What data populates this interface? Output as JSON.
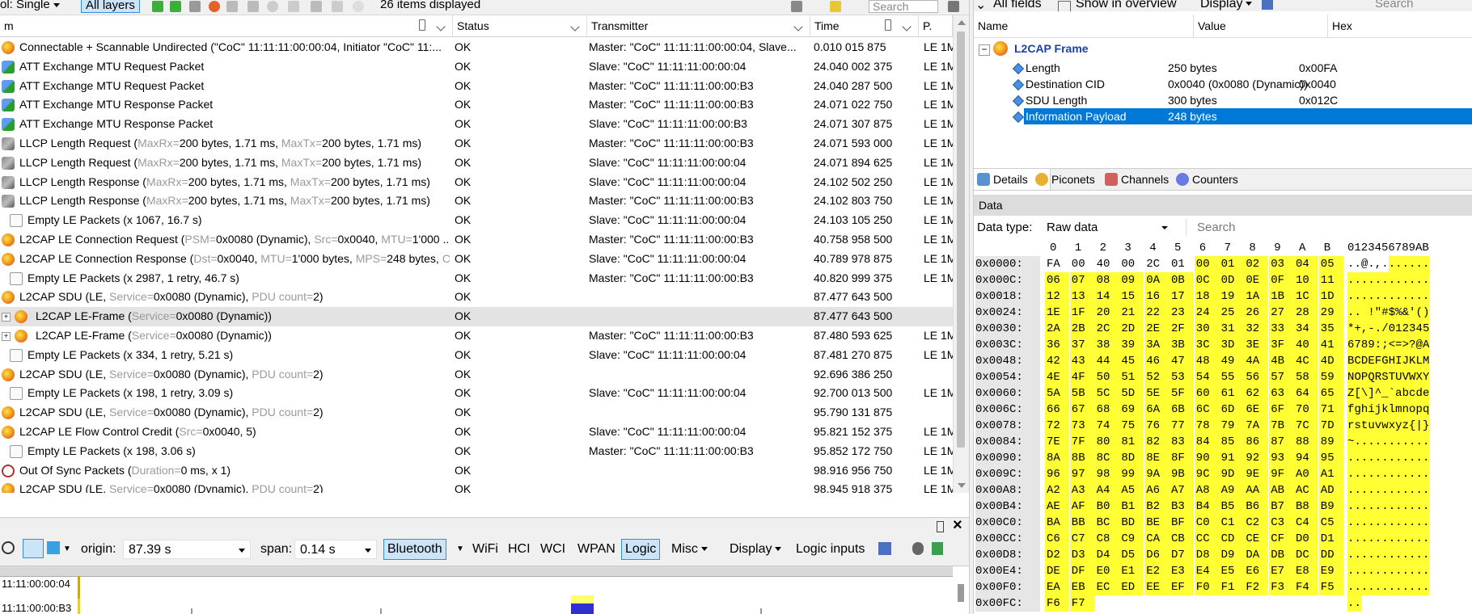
{
  "left_toolbar": {
    "pol_label": "ol: Single",
    "layers_label": "All layers",
    "items_displayed": "26 items displayed",
    "search_placeholder": "Search"
  },
  "packet_table": {
    "headers": {
      "name": "m",
      "status": "Status",
      "transmitter": "Transmitter",
      "time": "Time",
      "p": "P."
    },
    "rows": [
      {
        "icon": "exclamation-icon",
        "name": "Connectable + Scannable Undirected (\"CoC\" 11:11:11:00:00:04, Initiator \"CoC\" 11:...",
        "status": "OK",
        "transmitter": "Master: \"CoC\" 11:11:11:00:00:04, Slave...",
        "time": "0.010 015 875",
        "p": "LE 1M"
      },
      {
        "icon": "arrow-icon",
        "name": "ATT Exchange MTU Request Packet",
        "status": "OK",
        "transmitter": "Slave: \"CoC\" 11:11:11:00:00:04",
        "time": "24.040 002 375",
        "p": "LE 1M"
      },
      {
        "icon": "arrow-icon",
        "name": "ATT Exchange MTU Request Packet",
        "status": "OK",
        "transmitter": "Master: \"CoC\" 11:11:11:00:00:B3",
        "time": "24.040 287 500",
        "p": "LE 1M"
      },
      {
        "icon": "arrow-icon",
        "name": "ATT Exchange MTU Response Packet",
        "status": "OK",
        "transmitter": "Master: \"CoC\" 11:11:11:00:00:B3",
        "time": "24.071 022 750",
        "p": "LE 1M"
      },
      {
        "icon": "arrow-icon",
        "name": "ATT Exchange MTU Response Packet",
        "status": "OK",
        "transmitter": "Slave: \"CoC\" 11:11:11:00:00:B3",
        "time": "24.071 307 875",
        "p": "LE 1M"
      },
      {
        "icon": "llcp-icon",
        "name": "LLCP Length Request (",
        "g1": "MaxRx=",
        "v1": "200 bytes, 1.71 ms, ",
        "g2": "MaxTx=",
        "v2": "200 bytes, 1.71 ms)",
        "status": "OK",
        "transmitter": "Master: \"CoC\" 11:11:11:00:00:B3",
        "time": "24.071 593 000",
        "p": "LE 1M"
      },
      {
        "icon": "llcp-icon",
        "name": "LLCP Length Request (",
        "g1": "MaxRx=",
        "v1": "200 bytes, 1.71 ms, ",
        "g2": "MaxTx=",
        "v2": "200 bytes, 1.71 ms)",
        "status": "OK",
        "transmitter": "Slave: \"CoC\" 11:11:11:00:00:04",
        "time": "24.071 894 625",
        "p": "LE 1M"
      },
      {
        "icon": "llcp-icon",
        "name": "LLCP Length Response (",
        "g1": "MaxRx=",
        "v1": "200 bytes, 1.71 ms, ",
        "g2": "MaxTx=",
        "v2": "200 bytes, 1.71 ms)",
        "status": "OK",
        "transmitter": "Slave: \"CoC\" 11:11:11:00:00:04",
        "time": "24.102 502 250",
        "p": "LE 1M"
      },
      {
        "icon": "llcp-icon",
        "name": "LLCP Length Response (",
        "g1": "MaxRx=",
        "v1": "200 bytes, 1.71 ms, ",
        "g2": "MaxTx=",
        "v2": "200 bytes, 1.71 ms)",
        "status": "OK",
        "transmitter": "Master: \"CoC\" 11:11:11:00:00:B3",
        "time": "24.102 803 750",
        "p": "LE 1M"
      },
      {
        "icon": "empty-icon",
        "name": "Empty LE Packets (x 1067, 16.7 s)",
        "status": "OK",
        "transmitter": "Slave: \"CoC\" 11:11:11:00:00:04",
        "time": "24.103 105 250",
        "p": "LE 1M"
      },
      {
        "icon": "l2cap-icon",
        "name": "L2CAP LE Connection Request (",
        "g1": "PSM=",
        "v1": "0x0080 (Dynamic), ",
        "g2": "Src=",
        "v2": "0x0040, ",
        "g3": "MTU=",
        "v3": "1'000 ...",
        "status": "OK",
        "transmitter": "Master: \"CoC\" 11:11:11:00:00:B3",
        "time": "40.758 958 500",
        "p": "LE 1M"
      },
      {
        "icon": "l2cap-icon",
        "name": "L2CAP LE Connection Response (",
        "g1": "Dst=",
        "v1": "0x0040, ",
        "g2": "MTU=",
        "v2": "1'000 bytes, ",
        "g3": "MPS=",
        "v3": "248 bytes, ",
        "g4": "C...",
        "status": "OK",
        "transmitter": "Slave: \"CoC\" 11:11:11:00:00:04",
        "time": "40.789 978 875",
        "p": "LE 1M"
      },
      {
        "icon": "empty-icon",
        "name": "Empty LE Packets (x 2987, 1 retry, 46.7 s)",
        "status": "OK",
        "transmitter": "Master: \"CoC\" 11:11:11:00:00:B3",
        "time": "40.820 999 375",
        "p": "LE 1M"
      },
      {
        "icon": "l2cap-icon",
        "name": "L2CAP SDU (LE, ",
        "g1": "Service=",
        "v1": "0x0080 (Dynamic), ",
        "g2": "PDU count=",
        "v2": "2)",
        "status": "OK",
        "transmitter": "",
        "time": "87.477 643 500",
        "p": ""
      },
      {
        "icon": "l2cap-icon",
        "expand": true,
        "selected": true,
        "name": "L2CAP LE-Frame (",
        "g1": "Service=",
        "v1": "0x0080 (Dynamic))",
        "status": "OK",
        "transmitter": "",
        "time": "87.477 643 500",
        "p": ""
      },
      {
        "icon": "l2cap-icon",
        "expand": true,
        "name": "L2CAP LE-Frame (",
        "g1": "Service=",
        "v1": "0x0080 (Dynamic))",
        "status": "OK",
        "transmitter": "Master: \"CoC\" 11:11:11:00:00:B3",
        "time": "87.480 593 625",
        "p": "LE 1M"
      },
      {
        "icon": "empty-icon",
        "name": "Empty LE Packets (x 334, 1 retry, 5.21 s)",
        "status": "OK",
        "transmitter": "Slave: \"CoC\" 11:11:11:00:00:04",
        "time": "87.481 270 875",
        "p": "LE 1M"
      },
      {
        "icon": "l2cap-icon",
        "name": "L2CAP SDU (LE, ",
        "g1": "Service=",
        "v1": "0x0080 (Dynamic), ",
        "g2": "PDU count=",
        "v2": "2)",
        "status": "OK",
        "transmitter": "",
        "time": "92.696 386 250",
        "p": ""
      },
      {
        "icon": "empty-icon",
        "name": "Empty LE Packets (x 198, 1 retry, 3.09 s)",
        "status": "OK",
        "transmitter": "Slave: \"CoC\" 11:11:11:00:00:04",
        "time": "92.700 013 500",
        "p": "LE 1M"
      },
      {
        "icon": "l2cap-icon",
        "name": "L2CAP SDU (LE, ",
        "g1": "Service=",
        "v1": "0x0080 (Dynamic), ",
        "g2": "PDU count=",
        "v2": "2)",
        "status": "OK",
        "transmitter": "",
        "time": "95.790 131 875",
        "p": ""
      },
      {
        "icon": "l2cap-icon",
        "name": "L2CAP LE Flow Control Credit (",
        "g1": "Src=",
        "v1": "0x0040, 5)",
        "status": "OK",
        "transmitter": "Slave: \"CoC\" 11:11:11:00:00:04",
        "time": "95.821 152 375",
        "p": "LE 1M"
      },
      {
        "icon": "empty-icon",
        "name": "Empty LE Packets (x 198, 3.06 s)",
        "status": "OK",
        "transmitter": "Master: \"CoC\" 11:11:11:00:00:B3",
        "time": "95.852 172 750",
        "p": "LE 1M"
      },
      {
        "icon": "out-of-sync-icon",
        "name": "Out Of Sync Packets (",
        "g1": "Duration=",
        "v1": "0 ms, x 1)",
        "status": "OK",
        "transmitter": "",
        "time": "98.916 956 750",
        "p": "LE 1M"
      },
      {
        "icon": "l2cap-icon",
        "name": "L2CAP SDU (LE, ",
        "g1": "Service=",
        "v1": "0x0080 (Dynamic), ",
        "g2": "PDU count=",
        "v2": "2)",
        "status": "OK",
        "transmitter": "",
        "time": "98.945 918 375",
        "p": "LE 1M"
      }
    ]
  },
  "bottom_panel": {
    "origin_label": "origin:",
    "origin_value": "87.39 s",
    "span_label": "span:",
    "span_value": "0.14 s",
    "filters": [
      "Bluetooth",
      "WiFi",
      "HCI",
      "WCI",
      "WPAN",
      "Logic",
      "Misc",
      "Display",
      "Logic inputs"
    ],
    "timeline_labels": [
      "11:11:00:00:04",
      "11:11:00:00:B3"
    ]
  },
  "details": {
    "toolbar": {
      "all_fields": "All fields",
      "show_in_overview": "Show in overview",
      "display": "Display",
      "search_placeholder": "Search"
    },
    "headers": {
      "name": "Name",
      "value": "Value",
      "hex": "Hex"
    },
    "frame_title": "L2CAP Frame",
    "fields": [
      {
        "name": "Length",
        "value": "250 bytes",
        "hex": "0x00FA"
      },
      {
        "name": "Destination CID",
        "value": "0x0040 (0x0080 (Dynamic))",
        "hex": "0x0040"
      },
      {
        "name": "SDU Length",
        "value": "300 bytes",
        "hex": "0x012C"
      },
      {
        "name": "Information Payload",
        "value": "248 bytes",
        "hex": ""
      }
    ],
    "tabs": [
      "Details",
      "Piconets",
      "Channels",
      "Counters"
    ]
  },
  "data_panel": {
    "title": "Data",
    "data_type_label": "Data type:",
    "data_type_value": "Raw data",
    "search_placeholder": "Search",
    "column_headers": [
      "0",
      "1",
      "2",
      "3",
      "4",
      "5",
      "6",
      "7",
      "8",
      "9",
      "A",
      "B"
    ],
    "ascii_header": "0123456789AB",
    "offsets": [
      "0x0000:",
      "0x000C:",
      "0x0018:",
      "0x0024:",
      "0x0030:",
      "0x003C:",
      "0x0048:",
      "0x0054:",
      "0x0060:",
      "0x006C:",
      "0x0078:",
      "0x0084:",
      "0x0090:",
      "0x009C:",
      "0x00A8:",
      "0x00B4:",
      "0x00C0:",
      "0x00CC:",
      "0x00D8:",
      "0x00E4:",
      "0x00F0:",
      "0x00FC:"
    ],
    "rows": [
      "FA 00 40 00 2C 01 00 01 02 03 04 05",
      "06 07 08 09 0A 0B 0C 0D 0E 0F 10 11",
      "12 13 14 15 16 17 18 19 1A 1B 1C 1D",
      "1E 1F 20 21 22 23 24 25 26 27 28 29",
      "2A 2B 2C 2D 2E 2F 30 31 32 33 34 35",
      "36 37 38 39 3A 3B 3C 3D 3E 3F 40 41",
      "42 43 44 45 46 47 48 49 4A 4B 4C 4D",
      "4E 4F 50 51 52 53 54 55 56 57 58 59",
      "5A 5B 5C 5D 5E 5F 60 61 62 63 64 65",
      "66 67 68 69 6A 6B 6C 6D 6E 6F 70 71",
      "72 73 74 75 76 77 78 79 7A 7B 7C 7D",
      "7E 7F 80 81 82 83 84 85 86 87 88 89",
      "8A 8B 8C 8D 8E 8F 90 91 92 93 94 95",
      "96 97 98 99 9A 9B 9C 9D 9E 9F A0 A1",
      "A2 A3 A4 A5 A6 A7 A8 A9 AA AB AC AD",
      "AE AF B0 B1 B2 B3 B4 B5 B6 B7 B8 B9",
      "BA BB BC BD BE BF C0 C1 C2 C3 C4 C5",
      "C6 C7 C8 C9 CA CB CC CD CE CF D0 D1",
      "D2 D3 D4 D5 D6 D7 D8 D9 DA DB DC DD",
      "DE DF E0 E1 E2 E3 E4 E5 E6 E7 E8 E9",
      "EA EB EC ED EE EF F0 F1 F2 F3 F4 F5",
      "F6 F7"
    ],
    "ascii": [
      "..@.,.......",
      "............",
      "............",
      ".. !\"#$%&'()",
      "*+,-./012345",
      "6789:;<=>?@A",
      "BCDEFGHIJKLM",
      "NOPQRSTUVWXY",
      "Z[\\]^_`abcde",
      "fghijklmnopq",
      "rstuvwxyz{|}",
      "~...........",
      "............",
      "............",
      "............",
      "............",
      "............",
      "............",
      "............",
      "............",
      "............",
      ".."
    ],
    "highlight_color": "#ffff33"
  }
}
